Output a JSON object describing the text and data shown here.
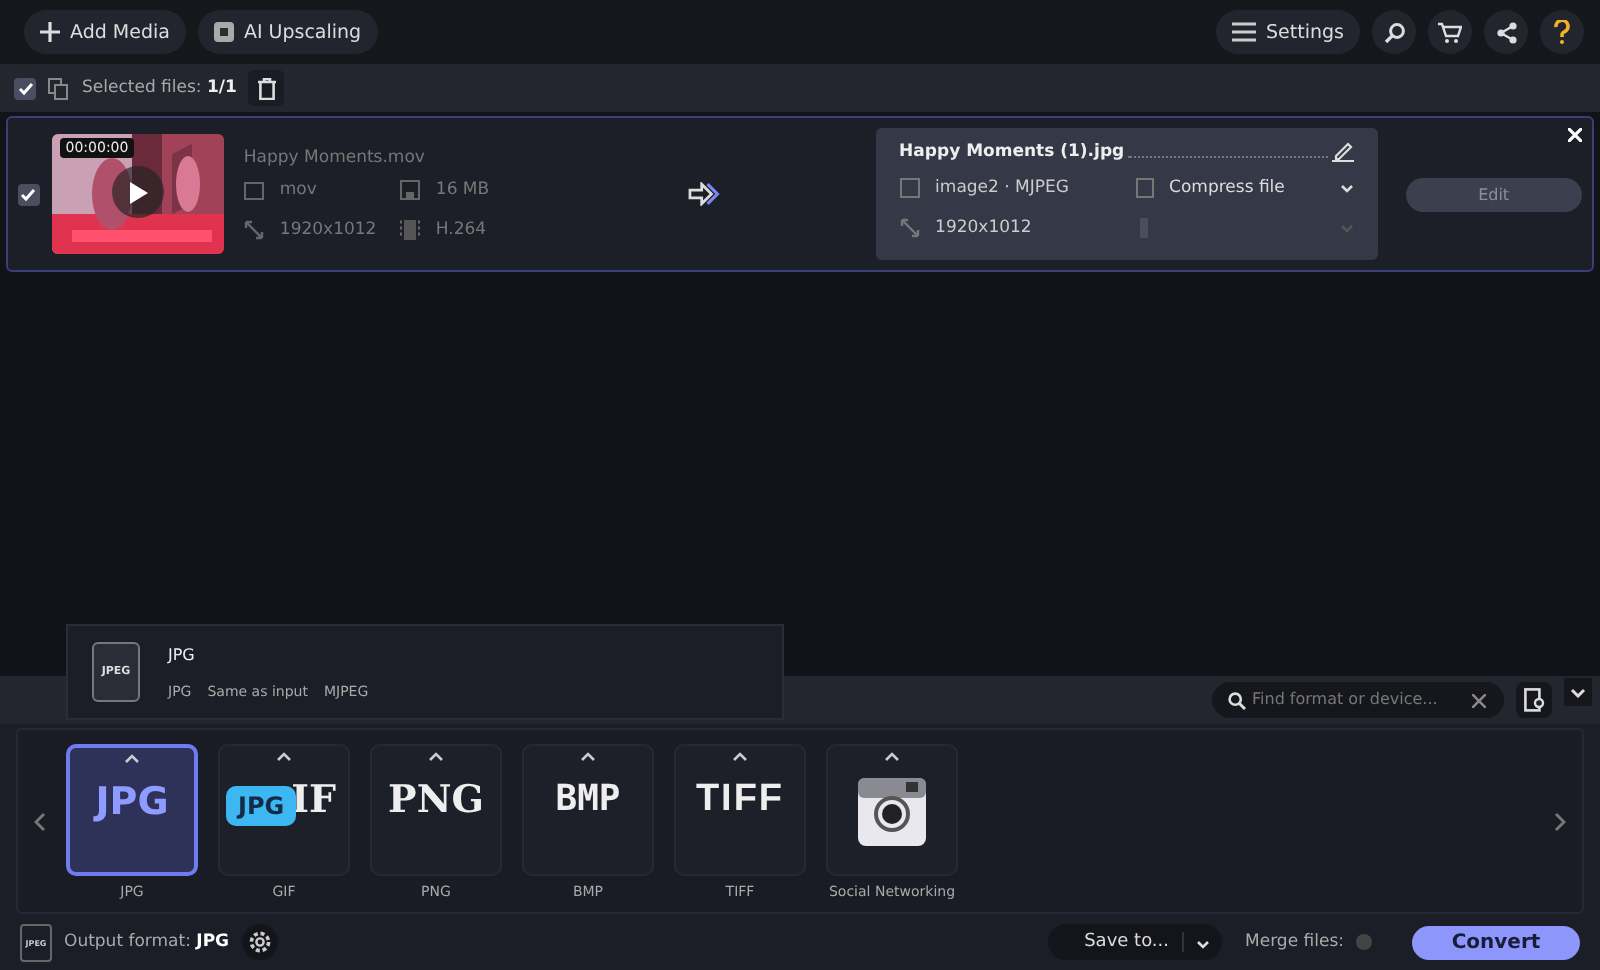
{
  "toolbar": {
    "buttons": [
      {
        "label": "Add Media",
        "kind": "add"
      },
      {
        "label": "AI Upscaling",
        "kind": "ai"
      }
    ],
    "settings": "Settings"
  },
  "selection": {
    "checked": true,
    "label": "Selected files:",
    "count": "1/1"
  },
  "file": {
    "checked": true,
    "duration": "00:00:00",
    "name": "Happy Moments.mov",
    "format": "mov",
    "size": "16 MB",
    "resolution": "1920x1012",
    "codec": "H.264"
  },
  "output": {
    "name": "Happy Moments (1).jpg",
    "codec": "image2 · MJPEG",
    "compression": "Compress file",
    "resolution": "1920x1012",
    "edit": "Edit",
    "edit_disabled": true
  },
  "preset_popup": {
    "icon": "JPEG",
    "title": "JPG",
    "details": [
      "JPG",
      "Same as input",
      "MJPEG"
    ]
  },
  "search": {
    "placeholder": "Find format or device..."
  },
  "formats": [
    {
      "label": "JPG",
      "logo": "JPG",
      "kind": "sans",
      "selected": true
    },
    {
      "label": "GIF",
      "logo": "IF",
      "kind": "serif",
      "selected": false
    },
    {
      "label": "PNG",
      "logo": "PNG",
      "kind": "serif",
      "selected": false
    },
    {
      "label": "BMP",
      "logo": "BMP",
      "kind": "block",
      "selected": false
    },
    {
      "label": "TIFF",
      "logo": "TIFF",
      "kind": "stripe",
      "selected": false
    },
    {
      "label": "Social Networking",
      "kind": "camera",
      "selected": false
    }
  ],
  "tooltip": "JPG",
  "footer": {
    "icon": "JPEG",
    "label": "Output format:",
    "value": "JPG",
    "save": "Save to...",
    "merge": "Merge files:",
    "merge_on": false,
    "convert": "Convert"
  }
}
